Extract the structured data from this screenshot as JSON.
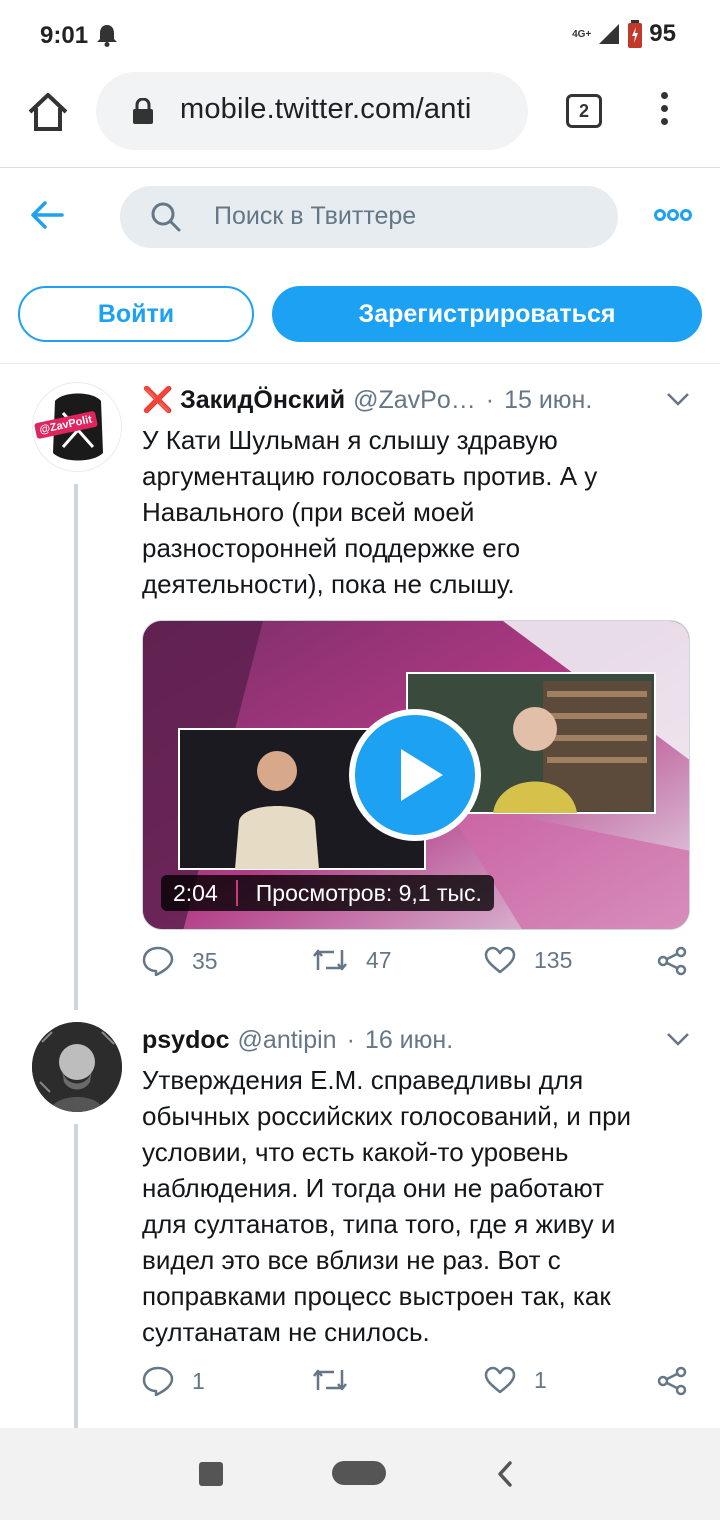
{
  "status_bar": {
    "time": "9:01",
    "network": "4G+",
    "battery": "95",
    "icons": [
      "bell-icon",
      "signal-icon",
      "battery-icon"
    ]
  },
  "browser": {
    "url": "mobile.twitter.com/anti",
    "tab_count": "2",
    "icons": [
      "home-icon",
      "lock-icon",
      "tabs-icon",
      "overflow-menu-icon"
    ]
  },
  "twitter": {
    "search_placeholder": "Поиск в Твиттере",
    "login_label": "Войти",
    "signup_label": "Зарегистрироваться",
    "accent_color": "#1da1f2"
  },
  "tweets": [
    {
      "name": "❌ ЗакидÖнский",
      "handle": "@ZavPo…",
      "date": "15 июн.",
      "avatar_text": "@ZavPolit",
      "text": "У Кати Шульман я слышу здравую аргументацию голосовать против. А у Навального (при всей моей разносторонней поддержке его деятельности), пока не слышу.",
      "video": {
        "duration": "2:04",
        "views": "Просмотров: 9,1 тыс."
      },
      "replies": "35",
      "retweets": "47",
      "likes": "135"
    },
    {
      "name": "psydoc",
      "handle": "@antipin",
      "date": "16 июн.",
      "text": "Утверждения Е.М.  справедливы для обычных российских голосований, и при условии, что есть какой-то уровень наблюдения. И тогда они не работают для султанатов, типа того, где я живу и видел это все вблизи не раз. Вот с поправками процесс выстроен так, как султанатам не снилось.",
      "replies": "1",
      "retweets": "",
      "likes": "1"
    }
  ]
}
